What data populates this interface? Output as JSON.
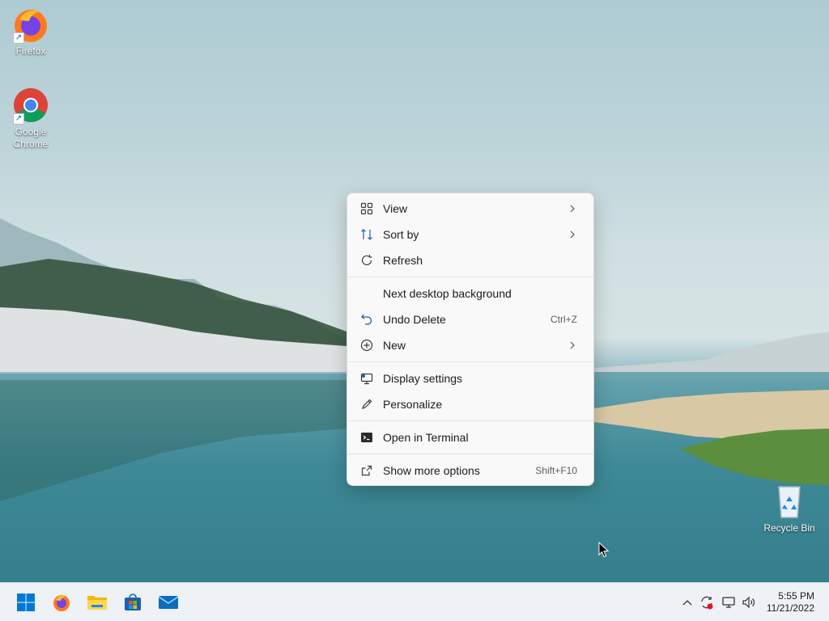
{
  "desktop": {
    "icons": [
      {
        "label": "Firefox",
        "icon": "firefox-icon"
      },
      {
        "label": "Google Chrome",
        "icon": "chrome-icon"
      },
      {
        "label": "Recycle Bin",
        "icon": "recycle-bin-icon"
      }
    ]
  },
  "context_menu": {
    "items": [
      {
        "label": "View",
        "icon": "grid-icon",
        "submenu": true
      },
      {
        "label": "Sort by",
        "icon": "sort-icon",
        "submenu": true
      },
      {
        "label": "Refresh",
        "icon": "refresh-icon"
      },
      {
        "label": "Next desktop background"
      },
      {
        "label": "Undo Delete",
        "icon": "undo-icon",
        "shortcut": "Ctrl+Z"
      },
      {
        "label": "New",
        "icon": "plus-circle-icon",
        "submenu": true
      },
      {
        "label": "Display settings",
        "icon": "display-icon"
      },
      {
        "label": "Personalize",
        "icon": "pen-icon"
      },
      {
        "label": "Open in Terminal",
        "icon": "terminal-icon"
      },
      {
        "label": "Show more options",
        "icon": "share-icon",
        "shortcut": "Shift+F10"
      }
    ]
  },
  "taskbar": {
    "pinned": [
      "start-button",
      "firefox",
      "file-explorer",
      "microsoft-store",
      "mail"
    ],
    "tray": [
      "chevron-up-icon",
      "sync-icon",
      "network-icon",
      "volume-icon"
    ],
    "time": "5:55 PM",
    "date": "11/21/2022"
  },
  "colors": {
    "accent": "#0067c0",
    "menu_bg": "#f9f9f9",
    "taskbar_bg": "#eef1f5"
  }
}
